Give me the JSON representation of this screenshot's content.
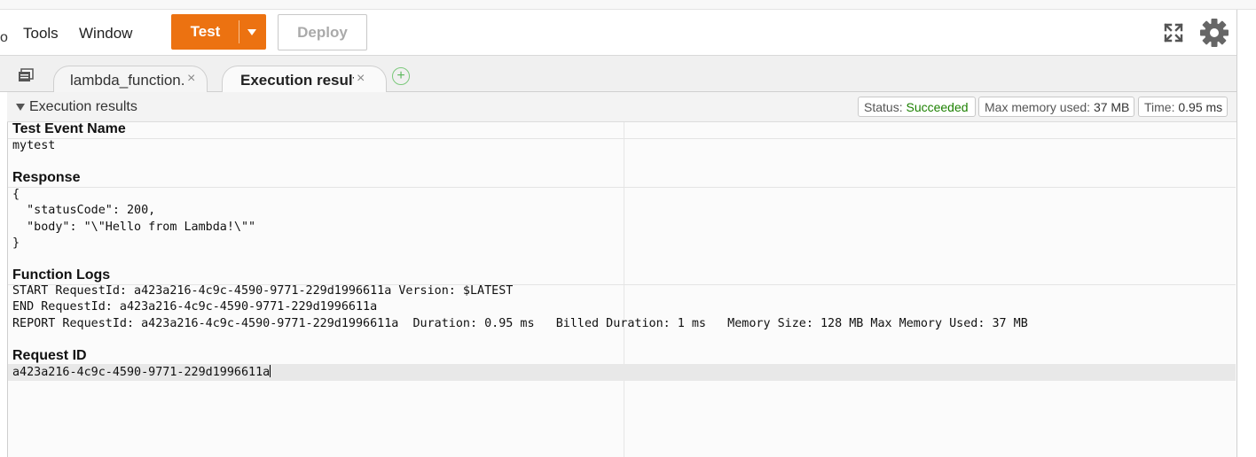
{
  "menu": {
    "partial": "o",
    "tools": "Tools",
    "window": "Window"
  },
  "toolbar": {
    "test_label": "Test",
    "deploy_label": "Deploy"
  },
  "tabs": [
    {
      "label": "lambda_function.",
      "close": "×"
    },
    {
      "label": "Execution results",
      "close": "×"
    }
  ],
  "panel": {
    "title": "Execution results",
    "status_key": "Status:",
    "status_value": "Succeeded",
    "memory_key": "Max memory used:",
    "memory_value": "37 MB",
    "time_key": "Time:",
    "time_value": "0.95 ms"
  },
  "sections": {
    "test_event": {
      "title": "Test Event Name",
      "value": "mytest"
    },
    "response": {
      "title": "Response",
      "lines": [
        "{",
        "  \"statusCode\": 200,",
        "  \"body\": \"\\\"Hello from Lambda!\\\"\"",
        "}"
      ]
    },
    "logs": {
      "title": "Function Logs",
      "lines": [
        "START RequestId: a423a216-4c9c-4590-9771-229d1996611a Version: $LATEST",
        "END RequestId: a423a216-4c9c-4590-9771-229d1996611a",
        "REPORT RequestId: a423a216-4c9c-4590-9771-229d1996611a  Duration: 0.95 ms   Billed Duration: 1 ms   Memory Size: 128 MB Max Memory Used: 37 MB"
      ]
    },
    "request_id": {
      "title": "Request ID",
      "value": "a423a216-4c9c-4590-9771-229d1996611a"
    }
  },
  "colors": {
    "test_button": "#ec7211",
    "status_ok": "#1d8102"
  },
  "icons": [
    "fullscreen-icon",
    "gear-icon",
    "file-navigator-icon",
    "add-tab-icon",
    "caret-down-icon"
  ]
}
